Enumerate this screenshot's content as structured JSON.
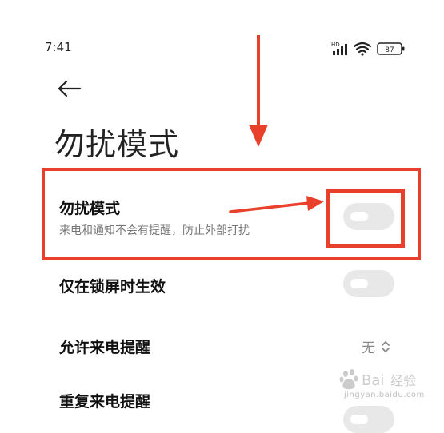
{
  "status_bar": {
    "time": "7:41",
    "battery": "87",
    "signal_label": "HD",
    "icons": [
      "signal-icon",
      "wifi-icon",
      "battery-icon"
    ]
  },
  "header": {
    "back_icon": "arrow-left-icon",
    "title": "勿扰模式"
  },
  "settings": {
    "dnd": {
      "title": "勿扰模式",
      "subtitle": "来电和通知不会有提醒，防止外部打扰",
      "enabled": false
    },
    "lockscreen_only": {
      "title": "仅在锁屏时生效",
      "enabled": false
    },
    "allow_calls": {
      "title": "允许来电提醒",
      "value": "无"
    },
    "repeat_calls": {
      "title": "重复来电提醒",
      "enabled": false
    }
  },
  "colors": {
    "annotation": "#e8402a",
    "toggle_off": "#e8e8e8"
  },
  "watermark": {
    "text": "jingyan.baidu.com"
  }
}
